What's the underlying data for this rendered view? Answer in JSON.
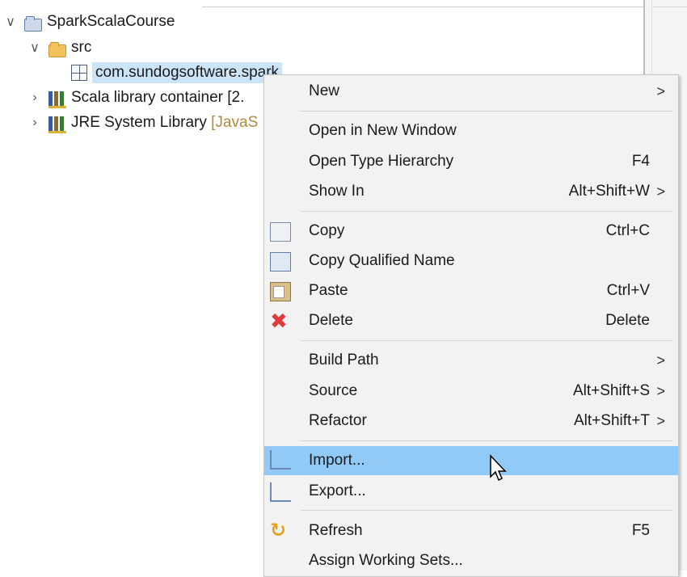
{
  "tree": {
    "items": [
      {
        "label": "SparkScalaCourse",
        "expanded": true
      },
      {
        "label": "src",
        "expanded": true
      },
      {
        "label": "com.sundogsoftware.spark",
        "selected": true
      },
      {
        "label": "Scala library container [2.",
        "expanded": false
      },
      {
        "label": "JRE System Library",
        "suffix": "[JavaS",
        "expanded": false
      }
    ]
  },
  "menu": {
    "items": [
      {
        "label": "New",
        "accelerator": "",
        "submenu": ">"
      },
      {
        "label": "Open in New Window",
        "accelerator": ""
      },
      {
        "label": "Open Type Hierarchy",
        "accelerator": "F4"
      },
      {
        "label": "Show In",
        "accelerator": "Alt+Shift+W",
        "submenu": ">"
      },
      {
        "label": "Copy",
        "accelerator": "Ctrl+C",
        "icon": "copy-icon"
      },
      {
        "label": "Copy Qualified Name",
        "accelerator": "",
        "icon": "copy-qualified-name-icon"
      },
      {
        "label": "Paste",
        "accelerator": "Ctrl+V",
        "icon": "paste-icon"
      },
      {
        "label": "Delete",
        "accelerator": "Delete",
        "icon": "delete-icon"
      },
      {
        "label": "Build Path",
        "accelerator": "",
        "submenu": ">"
      },
      {
        "label": "Source",
        "accelerator": "Alt+Shift+S",
        "submenu": ">"
      },
      {
        "label": "Refactor",
        "accelerator": "Alt+Shift+T",
        "submenu": ">"
      },
      {
        "label": "Import...",
        "accelerator": "",
        "icon": "import-icon",
        "hovered": true
      },
      {
        "label": "Export...",
        "accelerator": "",
        "icon": "export-icon"
      },
      {
        "label": "Refresh",
        "accelerator": "F5",
        "icon": "refresh-icon"
      },
      {
        "label": "Assign Working Sets...",
        "accelerator": ""
      }
    ]
  },
  "colors": {
    "hover": "#91c9f7",
    "menu_bg": "#f2f2f2",
    "selection": "#cce4f7"
  }
}
